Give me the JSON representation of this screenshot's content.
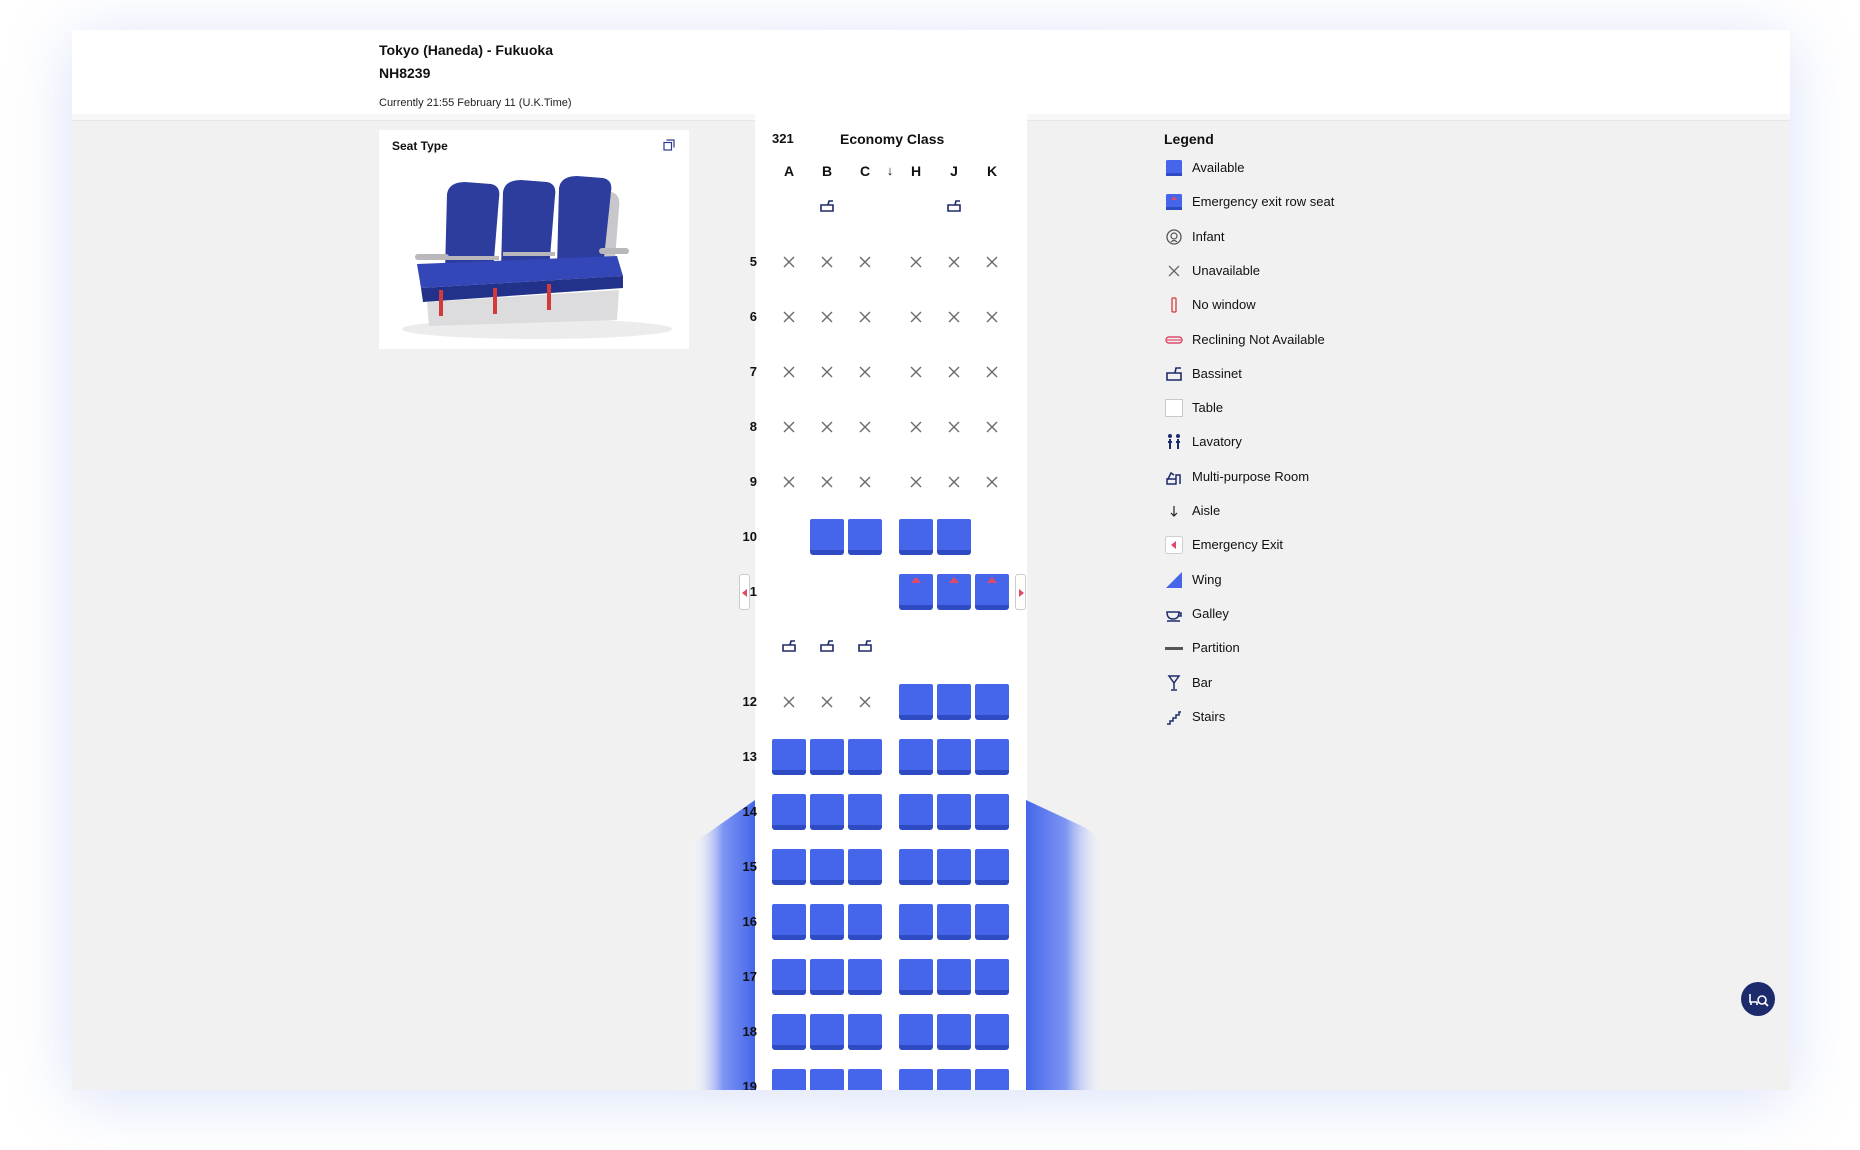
{
  "header": {
    "route": "Tokyo (Haneda)  -  Fukuoka",
    "flight_number": "NH8239",
    "current_time": "Currently 21:55 February 11 (U.K.Time)"
  },
  "seat_type_panel": {
    "title": "Seat Type",
    "expand_icon": "expand-icon",
    "image": "economy-seat-illustration"
  },
  "cabin": {
    "aircraft_code": "321",
    "class_name": "Economy Class",
    "columns": [
      "A",
      "B",
      "C",
      "H",
      "J",
      "K"
    ],
    "aisle_symbol": "↓",
    "rows": [
      {
        "number": "",
        "seats": [
          "",
          "bassinet",
          "",
          "",
          "bassinet",
          ""
        ]
      },
      {
        "number": "5",
        "seats": [
          "unavailable",
          "unavailable",
          "unavailable",
          "unavailable",
          "unavailable",
          "unavailable"
        ]
      },
      {
        "number": "6",
        "seats": [
          "unavailable",
          "unavailable",
          "unavailable",
          "unavailable",
          "unavailable",
          "unavailable"
        ]
      },
      {
        "number": "7",
        "seats": [
          "unavailable",
          "unavailable",
          "unavailable",
          "unavailable",
          "unavailable",
          "unavailable"
        ]
      },
      {
        "number": "8",
        "seats": [
          "unavailable",
          "unavailable",
          "unavailable",
          "unavailable",
          "unavailable",
          "unavailable"
        ]
      },
      {
        "number": "9",
        "seats": [
          "unavailable",
          "unavailable",
          "unavailable",
          "unavailable",
          "unavailable",
          "unavailable"
        ]
      },
      {
        "number": "10",
        "seats": [
          "",
          "available",
          "available",
          "available",
          "available",
          ""
        ]
      },
      {
        "number": "11",
        "seats": [
          "",
          "",
          "",
          "exit-row",
          "exit-row",
          "exit-row"
        ],
        "emergency_exit": true
      },
      {
        "number": "",
        "seats": [
          "bassinet",
          "bassinet",
          "bassinet",
          "",
          "",
          ""
        ]
      },
      {
        "number": "12",
        "seats": [
          "unavailable",
          "unavailable",
          "unavailable",
          "available",
          "available",
          "available"
        ]
      },
      {
        "number": "13",
        "seats": [
          "available",
          "available",
          "available",
          "available",
          "available",
          "available"
        ]
      },
      {
        "number": "14",
        "seats": [
          "available",
          "available",
          "available",
          "available",
          "available",
          "available"
        ]
      },
      {
        "number": "15",
        "seats": [
          "available",
          "available",
          "available",
          "available",
          "available",
          "available"
        ]
      },
      {
        "number": "16",
        "seats": [
          "available",
          "available",
          "available",
          "available",
          "available",
          "available"
        ]
      },
      {
        "number": "17",
        "seats": [
          "available",
          "available",
          "available",
          "available",
          "available",
          "available"
        ]
      },
      {
        "number": "18",
        "seats": [
          "available",
          "available",
          "available",
          "available",
          "available",
          "available"
        ]
      },
      {
        "number": "19",
        "seats": [
          "available",
          "available",
          "available",
          "available",
          "available",
          "available"
        ]
      }
    ]
  },
  "legend": {
    "title": "Legend",
    "items": [
      {
        "label": "Available",
        "icon": "available-seat-icon"
      },
      {
        "label": "Emergency exit row seat",
        "icon": "exit-row-seat-icon"
      },
      {
        "label": "Infant",
        "icon": "infant-icon"
      },
      {
        "label": "Unavailable",
        "icon": "unavailable-icon"
      },
      {
        "label": "No window",
        "icon": "no-window-icon"
      },
      {
        "label": "Reclining Not Available",
        "icon": "reclining-not-available-icon"
      },
      {
        "label": "Bassinet",
        "icon": "bassinet-icon"
      },
      {
        "label": "Table",
        "icon": "table-icon"
      },
      {
        "label": "Lavatory",
        "icon": "lavatory-icon"
      },
      {
        "label": "Multi-purpose Room",
        "icon": "multi-purpose-room-icon"
      },
      {
        "label": "Aisle",
        "icon": "aisle-icon"
      },
      {
        "label": "Emergency Exit",
        "icon": "emergency-exit-icon"
      },
      {
        "label": "Wing",
        "icon": "wing-icon"
      },
      {
        "label": "Galley",
        "icon": "galley-icon"
      },
      {
        "label": "Partition",
        "icon": "partition-icon"
      },
      {
        "label": "Bar",
        "icon": "bar-icon"
      },
      {
        "label": "Stairs",
        "icon": "stairs-icon"
      }
    ]
  },
  "colors": {
    "seat": "#4566ea",
    "seat_base": "#2f4bc4",
    "exit_marker": "#e04a6a",
    "fab": "#1d2a6b"
  },
  "fab": {
    "icon": "seat-search-icon"
  }
}
